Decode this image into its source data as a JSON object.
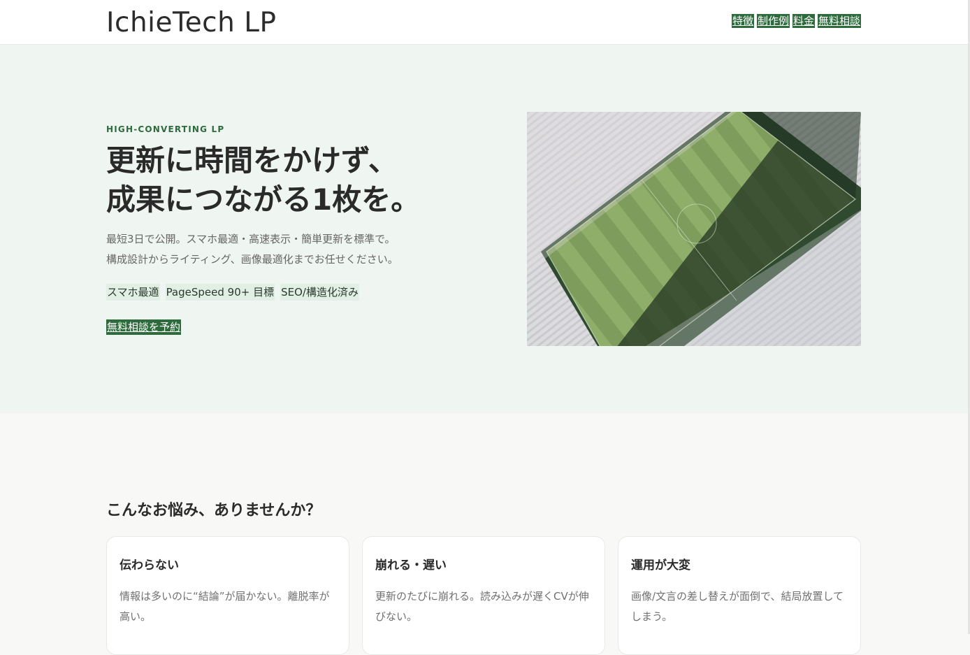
{
  "header": {
    "brand": "IchieTech LP",
    "nav": [
      "特徴",
      "制作例",
      "料金",
      "無料相談"
    ]
  },
  "hero": {
    "eyebrow": "HIGH-CONVERTING LP",
    "title_lines": [
      "更新に時間をかけず、",
      "成果につながる1枚を。"
    ],
    "desc_lines": [
      "最短3日で公開。スマホ最適・高速表示・簡単更新を標準で。",
      "構成設計からライティング、画像最適化までお任せください。"
    ],
    "badges": [
      "スマホ最適",
      "PageSpeed 90+ 目標",
      "SEO/構造化済み"
    ],
    "cta": "無料相談を予約",
    "image": "aerial-soccer-stadium"
  },
  "problems": {
    "title": "こんなお悩み、ありませんか？",
    "cards": [
      {
        "title": "伝わらない",
        "text": "情報は多いのに“結論”が届かない。離脱率が高い。"
      },
      {
        "title": "崩れる・遅い",
        "text": "更新のたびに崩れる。読み込みが遅くCVが伸びない。"
      },
      {
        "title": "運用が大変",
        "text": "画像/文言の差し替えが面倒で、結局放置してしまう。"
      }
    ]
  },
  "colors": {
    "accent": "#2e6b3c",
    "hero_bg": "#eff5f0",
    "page_bg": "#f8f9f6"
  }
}
